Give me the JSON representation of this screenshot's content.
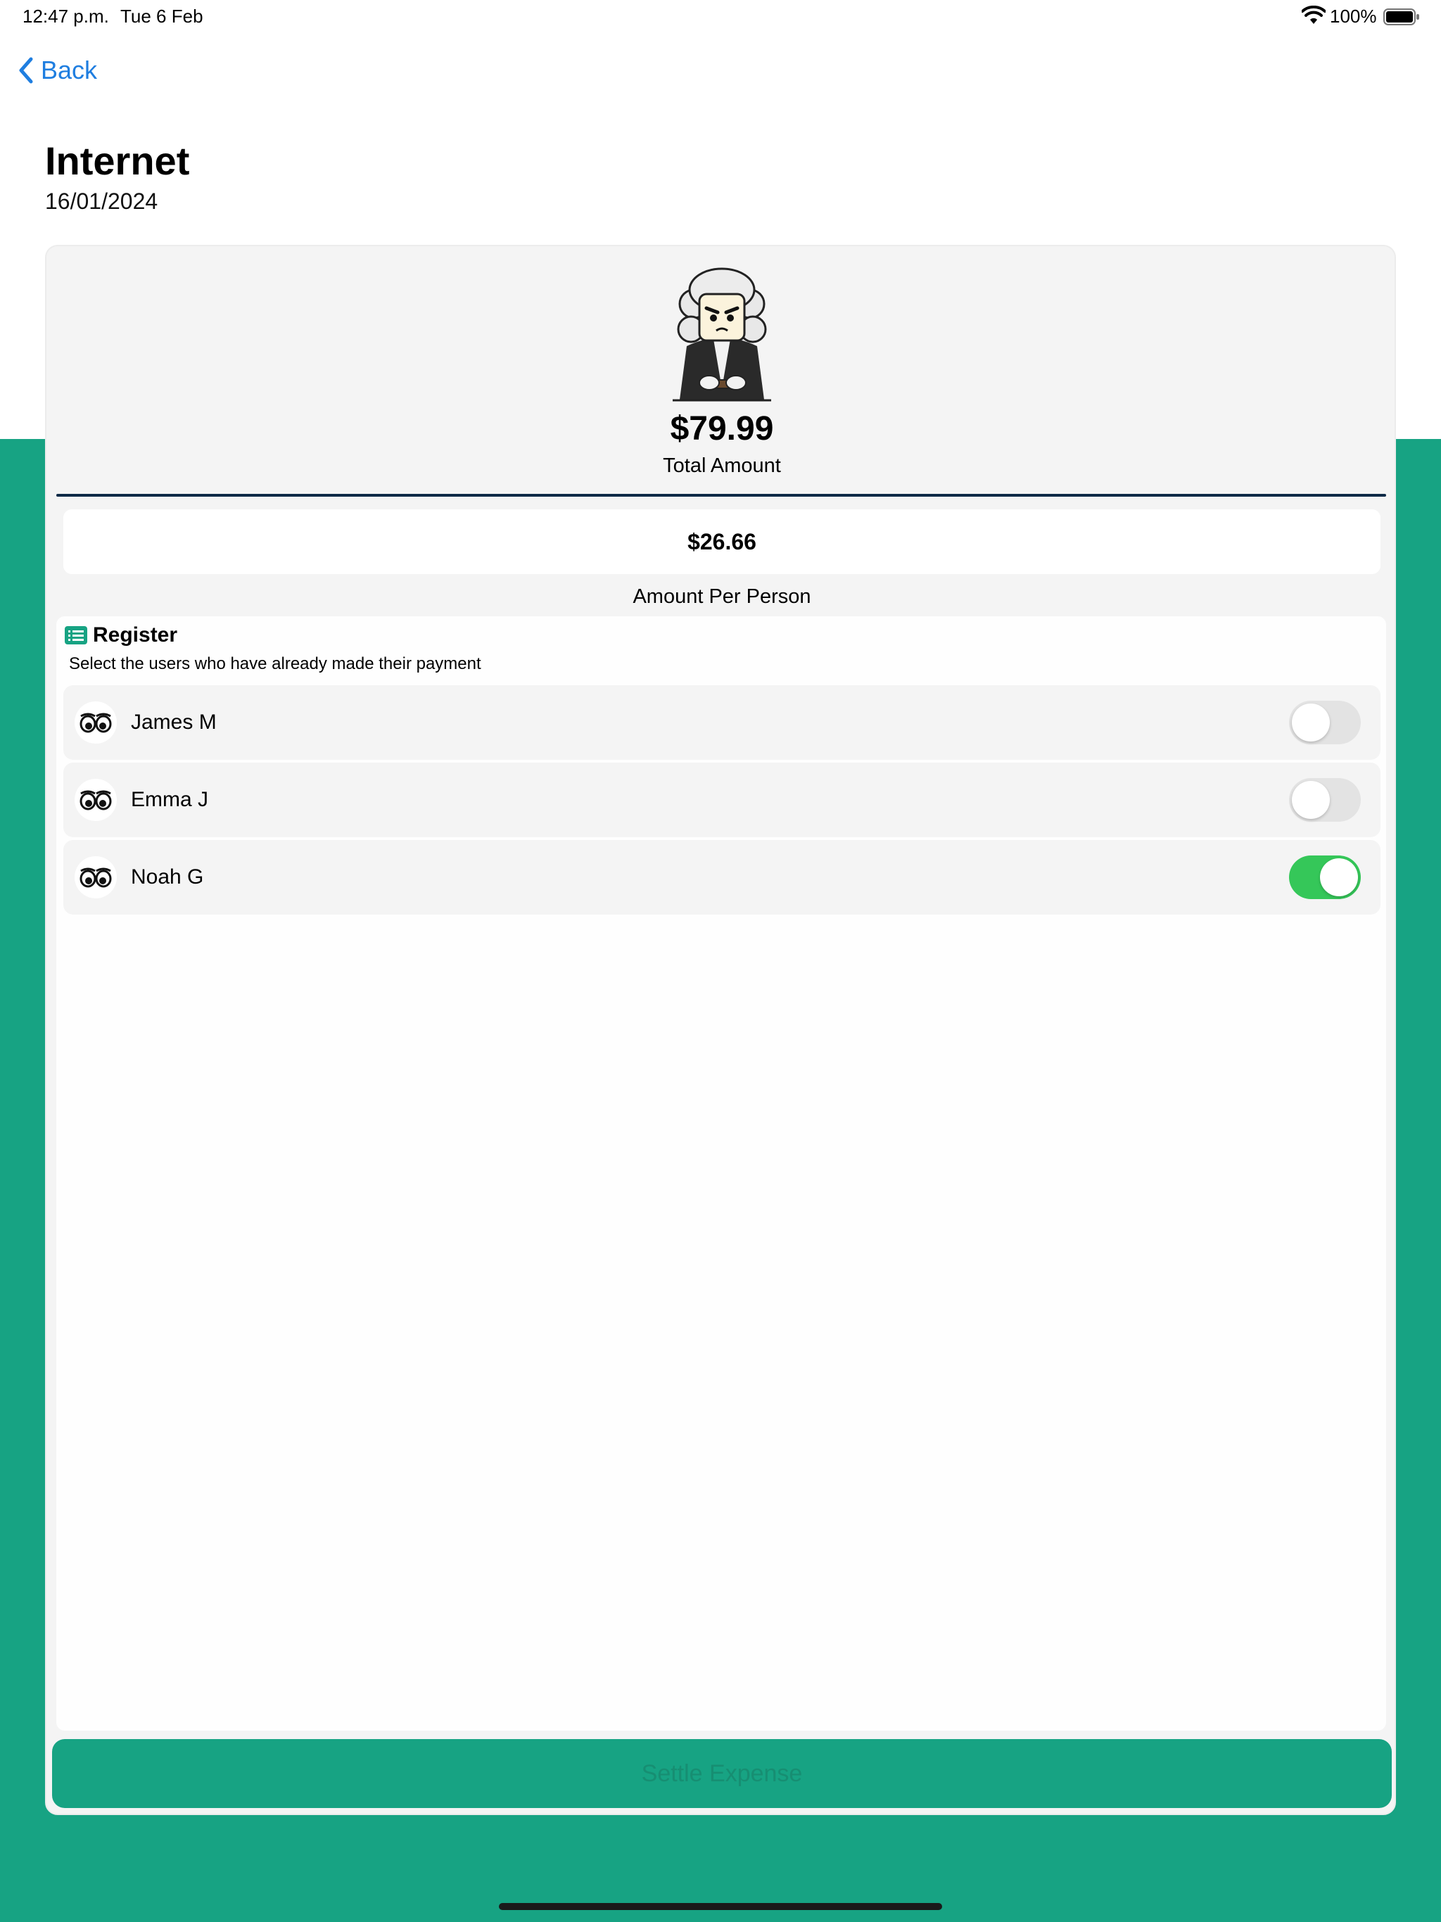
{
  "status_bar": {
    "time": "12:47 p.m.",
    "date": "Tue 6 Feb",
    "battery": "100%",
    "icons": [
      "wifi-icon",
      "battery-icon"
    ]
  },
  "nav": {
    "back_label": "Back",
    "back_icon": "chevron-left-icon",
    "accent_color": "#1f7ee0"
  },
  "expense": {
    "title": "Internet",
    "date": "16/01/2024",
    "total_amount": "$79.99",
    "total_label": "Total Amount",
    "per_person_amount": "$26.66",
    "per_person_label": "Amount Per Person",
    "avatar_icon": "judge-character-icon"
  },
  "register": {
    "icon": "list-icon",
    "title": "Register",
    "subtitle": "Select the users who have already made their payment",
    "users": [
      {
        "name": "James M",
        "avatar_icon": "eyes-icon",
        "paid": false
      },
      {
        "name": "Emma J",
        "avatar_icon": "eyes-icon",
        "paid": false
      },
      {
        "name": "Noah G",
        "avatar_icon": "eyes-icon",
        "paid": true
      }
    ]
  },
  "actions": {
    "settle_label": "Settle Expense"
  },
  "colors": {
    "brand_green": "#17a383",
    "toggle_on": "#35c759",
    "toggle_off": "#e3e3e3",
    "divider": "#0f2a47"
  }
}
